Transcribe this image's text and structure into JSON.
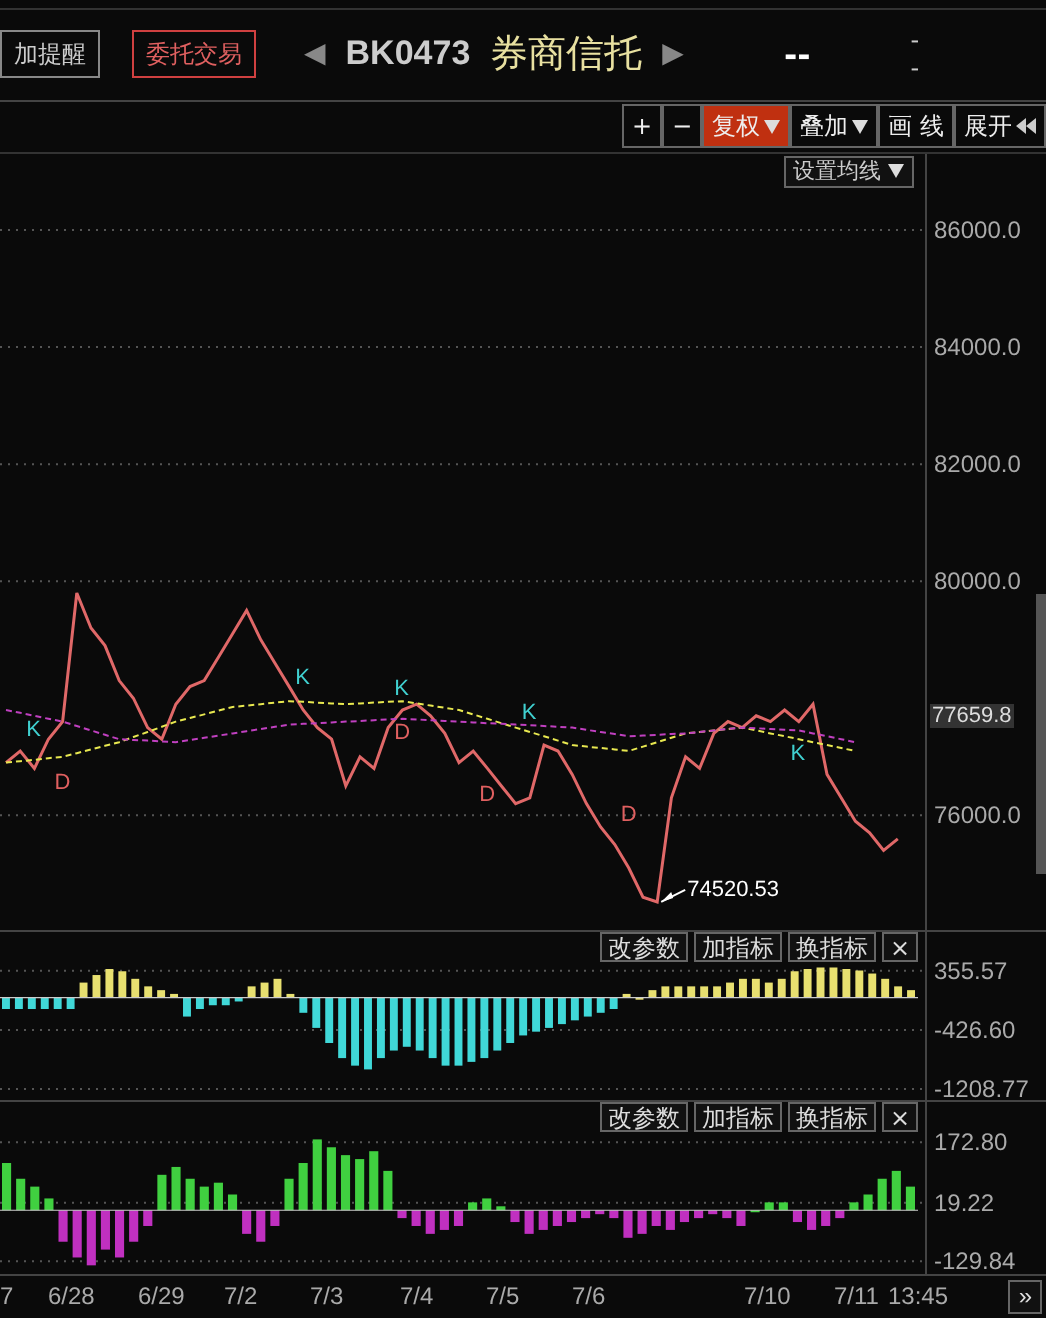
{
  "header": {
    "alert_button": "加提醒",
    "trade_button": "委托交易",
    "prev_arrow": "◀",
    "code": "BK0473",
    "name": "券商信托",
    "next_arrow": "▶",
    "price": "--",
    "change_top": "-",
    "change_bottom": "-"
  },
  "toolbar": [
    {
      "label": "+",
      "kind": "plain",
      "selected": false
    },
    {
      "label": "−",
      "kind": "plain",
      "selected": false
    },
    {
      "label": "复权",
      "kind": "dropdown",
      "selected": true
    },
    {
      "label": "叠加",
      "kind": "dropdown",
      "selected": false
    },
    {
      "label": "画 线",
      "kind": "plain",
      "selected": false
    },
    {
      "label": "展开",
      "kind": "expand",
      "selected": false
    }
  ],
  "main_chart": {
    "ma_button": "设置均线",
    "current_price": "77659.8",
    "min_label": "74520.53",
    "signals": [
      {
        "text": "K",
        "kind": "buy"
      },
      {
        "text": "D",
        "kind": "sell"
      },
      {
        "text": "K",
        "kind": "buy"
      },
      {
        "text": "K",
        "kind": "buy"
      },
      {
        "text": "D",
        "kind": "sell"
      },
      {
        "text": "D",
        "kind": "sell"
      },
      {
        "text": "K",
        "kind": "buy"
      },
      {
        "text": "D",
        "kind": "sell"
      },
      {
        "text": "K",
        "kind": "buy"
      }
    ],
    "chart_data": {
      "type": "line",
      "grid": true,
      "ylim": [
        74040,
        87300
      ],
      "yticks": [
        {
          "value": 76000,
          "label": "76000.0"
        },
        {
          "value": 80000,
          "label": "80000.0"
        },
        {
          "value": 82000,
          "label": "82000.0"
        },
        {
          "value": 84000,
          "label": "84000.0"
        },
        {
          "value": 86000,
          "label": "86000.0"
        }
      ],
      "series": [
        {
          "color": "#e06868",
          "values": [
            76900,
            77100,
            76800,
            77300,
            77600,
            79800,
            79200,
            78900,
            78300,
            78000,
            77500,
            77300,
            77900,
            78200,
            78300,
            78700,
            79100,
            79500,
            79000,
            78600,
            78200,
            77800,
            77500,
            77300,
            76500,
            77000,
            76800,
            77500,
            77800,
            77900,
            77700,
            77400,
            76900,
            77100,
            76800,
            76500,
            76200,
            76300,
            77200,
            77100,
            76700,
            76200,
            75800,
            75500,
            75100,
            74600,
            74520,
            76300,
            77000,
            76800,
            77400,
            77600,
            77500,
            77700,
            77600,
            77800,
            77600,
            77900,
            76700,
            76300,
            75900,
            75700,
            75400,
            75600
          ]
        },
        {
          "color": "#e8e850",
          "line_style": "dashed",
          "values": [
            76900,
            76925,
            76950,
            76975,
            77000,
            77062,
            77125,
            77188,
            77250,
            77338,
            77425,
            77512,
            77600,
            77662,
            77725,
            77788,
            77850,
            77875,
            77900,
            77925,
            77950,
            77938,
            77925,
            77912,
            77900,
            77912,
            77925,
            77938,
            77950,
            77912,
            77875,
            77838,
            77800,
            77725,
            77650,
            77575,
            77500,
            77425,
            77350,
            77275,
            77200,
            77175,
            77150,
            77125,
            77100,
            77175,
            77250,
            77325,
            77400,
            77425,
            77450,
            77475,
            77500,
            77450,
            77400,
            77350,
            77300,
            77250,
            77200,
            77150,
            77100
          ]
        },
        {
          "color": "#c040c0",
          "line_style": "dashed",
          "values": [
            77800,
            77750,
            77700,
            77650,
            77600,
            77525,
            77450,
            77375,
            77300,
            77288,
            77275,
            77262,
            77250,
            77288,
            77325,
            77362,
            77400,
            77438,
            77475,
            77512,
            77550,
            77562,
            77575,
            77588,
            77600,
            77612,
            77625,
            77638,
            77650,
            77638,
            77625,
            77612,
            77600,
            77588,
            77575,
            77562,
            77550,
            77538,
            77525,
            77512,
            77500,
            77462,
            77425,
            77388,
            77350,
            77362,
            77375,
            77388,
            77400,
            77425,
            77450,
            77475,
            77500,
            77488,
            77475,
            77462,
            77450,
            77400,
            77350,
            77300,
            77250
          ]
        }
      ]
    }
  },
  "indicators": [
    {
      "buttons": [
        "改参数",
        "加指标",
        "换指标",
        "×"
      ],
      "chart_data": {
        "type": "bar",
        "grid": true,
        "ylim": [
          -1355,
          870
        ],
        "yticks": [
          {
            "value": 355.57,
            "label": "355.57"
          },
          {
            "value": -426.6,
            "label": "-426.60"
          },
          {
            "value": -1208.77,
            "label": "-1208.77"
          }
        ],
        "series": [
          {
            "color": "#e8e070",
            "values": [
              null,
              null,
              null,
              null,
              null,
              null,
              200,
              300,
              380,
              350,
              250,
              150,
              100,
              50,
              null,
              null,
              null,
              null,
              null,
              150,
              200,
              250,
              50,
              null,
              null,
              null,
              null,
              null,
              null,
              null,
              null,
              null,
              null,
              null,
              null,
              null,
              null,
              null,
              null,
              null,
              null,
              null,
              null,
              null,
              null,
              null,
              null,
              null,
              50,
              0,
              100,
              150,
              150,
              150,
              150,
              150,
              200,
              250,
              250,
              200,
              250,
              350,
              380,
              400,
              400,
              380,
              360,
              320,
              250,
              150,
              100
            ]
          },
          {
            "color": "#40d8d8",
            "values": [
              -150,
              -150,
              -150,
              -150,
              -150,
              -150,
              null,
              null,
              null,
              null,
              null,
              null,
              null,
              null,
              -250,
              -150,
              -100,
              -100,
              -50,
              null,
              null,
              null,
              null,
              -200,
              -400,
              -600,
              -800,
              -900,
              -950,
              -800,
              -700,
              -650,
              -700,
              -800,
              -900,
              -900,
              -850,
              -800,
              -700,
              -600,
              -500,
              -450,
              -400,
              -350,
              -300,
              -250,
              -200,
              -150,
              null,
              null,
              null,
              null,
              null,
              null,
              null,
              null,
              null,
              null,
              null,
              null,
              null,
              null,
              null,
              null,
              null,
              null,
              null,
              null,
              null,
              null,
              null
            ]
          }
        ]
      }
    },
    {
      "buttons": [
        "改参数",
        "加指标",
        "换指标",
        "×"
      ],
      "chart_data": {
        "type": "bar",
        "grid": true,
        "ylim": [
          -162,
          275
        ],
        "yticks": [
          {
            "value": 172.8,
            "label": "172.80"
          },
          {
            "value": 19.22,
            "label": "19.22"
          },
          {
            "value": -129.84,
            "label": "-129.84"
          }
        ],
        "series": [
          {
            "color": "#40d040",
            "values": [
              120,
              80,
              60,
              30,
              null,
              null,
              null,
              null,
              null,
              null,
              null,
              90,
              110,
              80,
              60,
              70,
              40,
              null,
              null,
              null,
              80,
              120,
              180,
              160,
              140,
              130,
              150,
              100,
              null,
              null,
              null,
              null,
              null,
              20,
              30,
              10,
              null,
              null,
              null,
              null,
              null,
              null,
              null,
              null,
              null,
              null,
              null,
              null,
              null,
              null,
              null,
              null,
              null,
              0,
              20,
              20,
              null,
              null,
              null,
              null,
              20,
              40,
              80,
              100,
              60
            ]
          },
          {
            "color": "#c030c0",
            "values": [
              null,
              null,
              null,
              null,
              -80,
              -120,
              -140,
              -100,
              -120,
              -80,
              -40,
              null,
              null,
              null,
              null,
              null,
              null,
              -60,
              -80,
              -40,
              null,
              null,
              null,
              null,
              null,
              null,
              null,
              null,
              -20,
              -40,
              -60,
              -50,
              -40,
              null,
              null,
              null,
              -30,
              -60,
              -50,
              -40,
              -30,
              -20,
              -10,
              -20,
              -70,
              -60,
              -40,
              -50,
              -30,
              -20,
              -10,
              -20,
              -40,
              null,
              null,
              null,
              -30,
              -50,
              -40,
              -20,
              null,
              null,
              null,
              null,
              null
            ]
          }
        ]
      }
    }
  ],
  "x_axis": {
    "labels": [
      "7",
      "6/28",
      "6/29",
      "7/2",
      "7/3",
      "7/4",
      "7/5",
      "7/6",
      "7/10",
      "7/11"
    ],
    "time": "13:45",
    "scroll_button": "»"
  }
}
